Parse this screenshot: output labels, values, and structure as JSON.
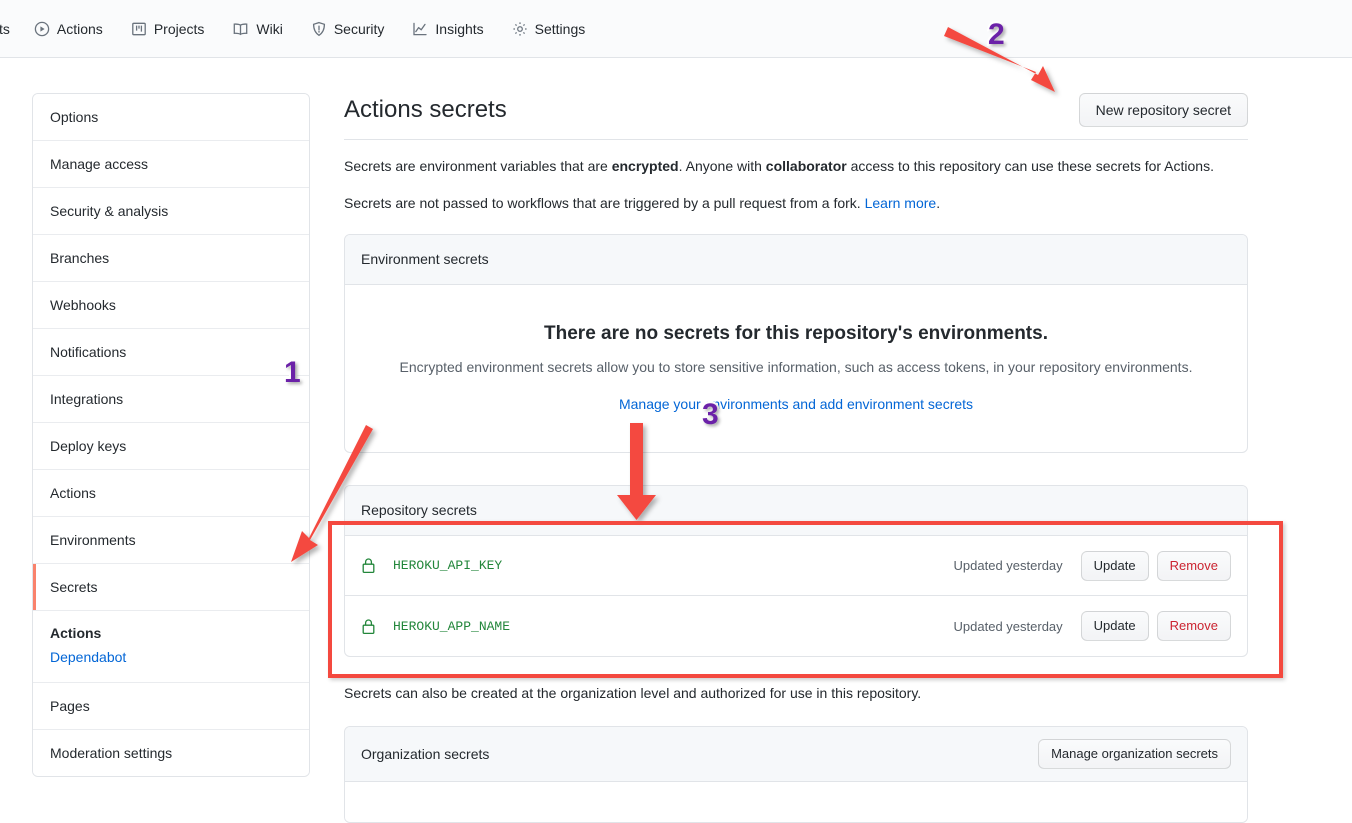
{
  "repo_nav": {
    "truncated_label": "sts",
    "items": [
      {
        "label": "Actions",
        "icon": "play-circle-icon"
      },
      {
        "label": "Projects",
        "icon": "project-board-icon"
      },
      {
        "label": "Wiki",
        "icon": "book-icon"
      },
      {
        "label": "Security",
        "icon": "shield-icon"
      },
      {
        "label": "Insights",
        "icon": "graph-icon"
      },
      {
        "label": "Settings",
        "icon": "gear-icon"
      }
    ]
  },
  "sidebar": {
    "items": [
      {
        "label": "Options",
        "selected": false
      },
      {
        "label": "Manage access",
        "selected": false
      },
      {
        "label": "Security & analysis",
        "selected": false
      },
      {
        "label": "Branches",
        "selected": false
      },
      {
        "label": "Webhooks",
        "selected": false
      },
      {
        "label": "Notifications",
        "selected": false
      },
      {
        "label": "Integrations",
        "selected": false
      },
      {
        "label": "Deploy keys",
        "selected": false
      },
      {
        "label": "Actions",
        "selected": false
      },
      {
        "label": "Environments",
        "selected": false
      },
      {
        "label": "Secrets",
        "selected": true
      }
    ],
    "secrets_group": {
      "title": "Actions",
      "sublink": "Dependabot"
    },
    "tail_items": [
      {
        "label": "Pages"
      },
      {
        "label": "Moderation settings"
      }
    ]
  },
  "main": {
    "title": "Actions secrets",
    "new_secret_button": "New repository secret",
    "desc_line1": {
      "part1": "Secrets are environment variables that are ",
      "bold1": "encrypted",
      "part2": ". Anyone with ",
      "bold2": "collaborator",
      "part3": " access to this repository can use these secrets for Actions."
    },
    "desc_line2": {
      "part1": "Secrets are not passed to workflows that are triggered by a pull request from a fork. ",
      "link": "Learn more",
      "part2": "."
    },
    "environment_secrets": {
      "header": "Environment secrets",
      "empty_title": "There are no secrets for this repository's environments.",
      "empty_desc": "Encrypted environment secrets allow you to store sensitive information, such as access tokens, in your repository environments.",
      "manage_link": "Manage your environments and add environment secrets"
    },
    "repository_secrets": {
      "header": "Repository secrets",
      "rows": [
        {
          "name": "HEROKU_API_KEY",
          "updated": "Updated yesterday",
          "update_label": "Update",
          "remove_label": "Remove",
          "icon": "lock-icon"
        },
        {
          "name": "HEROKU_APP_NAME",
          "updated": "Updated yesterday",
          "update_label": "Update",
          "remove_label": "Remove",
          "icon": "lock-icon"
        }
      ]
    },
    "org_note": "Secrets can also be created at the organization level and authorized for use in this repository.",
    "organization_secrets": {
      "header": "Organization secrets",
      "manage_button": "Manage organization secrets"
    }
  },
  "annotations": {
    "marker_1": "1",
    "marker_2": "2",
    "marker_3": "3",
    "arrow_color": "#f4493f",
    "marker_color": "#6b21a8",
    "highlight_box_color": "#f4493f"
  }
}
